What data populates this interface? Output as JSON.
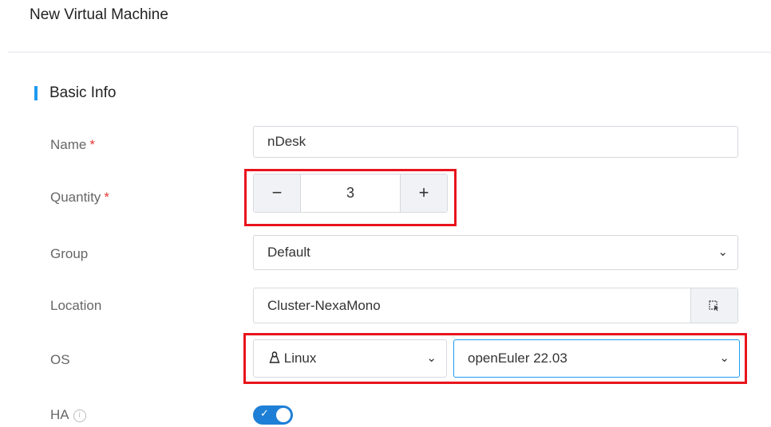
{
  "page": {
    "title": "New Virtual Machine"
  },
  "section": {
    "title": "Basic Info"
  },
  "fields": {
    "name": {
      "label": "Name",
      "required_mark": "*",
      "value": "nDesk"
    },
    "quantity": {
      "label": "Quantity",
      "required_mark": "*",
      "value": "3",
      "minus": "−",
      "plus": "+"
    },
    "group": {
      "label": "Group",
      "value": "Default"
    },
    "location": {
      "label": "Location",
      "value": "Cluster-NexaMono"
    },
    "os": {
      "label": "OS",
      "family": "Linux",
      "version": "openEuler 22.03"
    },
    "ha": {
      "label": "HA",
      "enabled": true
    }
  },
  "colors": {
    "accent": "#1e9bf0",
    "highlight": "#e8141c",
    "required": "#e53935",
    "toggle_on": "#1e7fd6"
  },
  "icons": {
    "dropdown": "chevron-down-icon",
    "location_picker": "cursor-select-icon",
    "os_family": "linux-icon",
    "ha_info": "info-icon"
  }
}
